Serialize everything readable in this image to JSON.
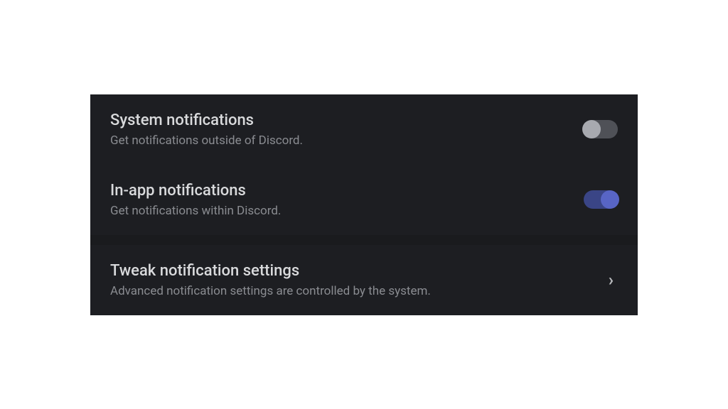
{
  "settings": [
    {
      "title": "System notifications",
      "description": "Get notifications outside of Discord.",
      "type": "toggle",
      "enabled": false
    },
    {
      "title": "In-app notifications",
      "description": "Get notifications within Discord.",
      "type": "toggle",
      "enabled": true
    },
    {
      "title": "Tweak notification settings",
      "description": "Advanced notification settings are controlled by the system.",
      "type": "link"
    }
  ]
}
